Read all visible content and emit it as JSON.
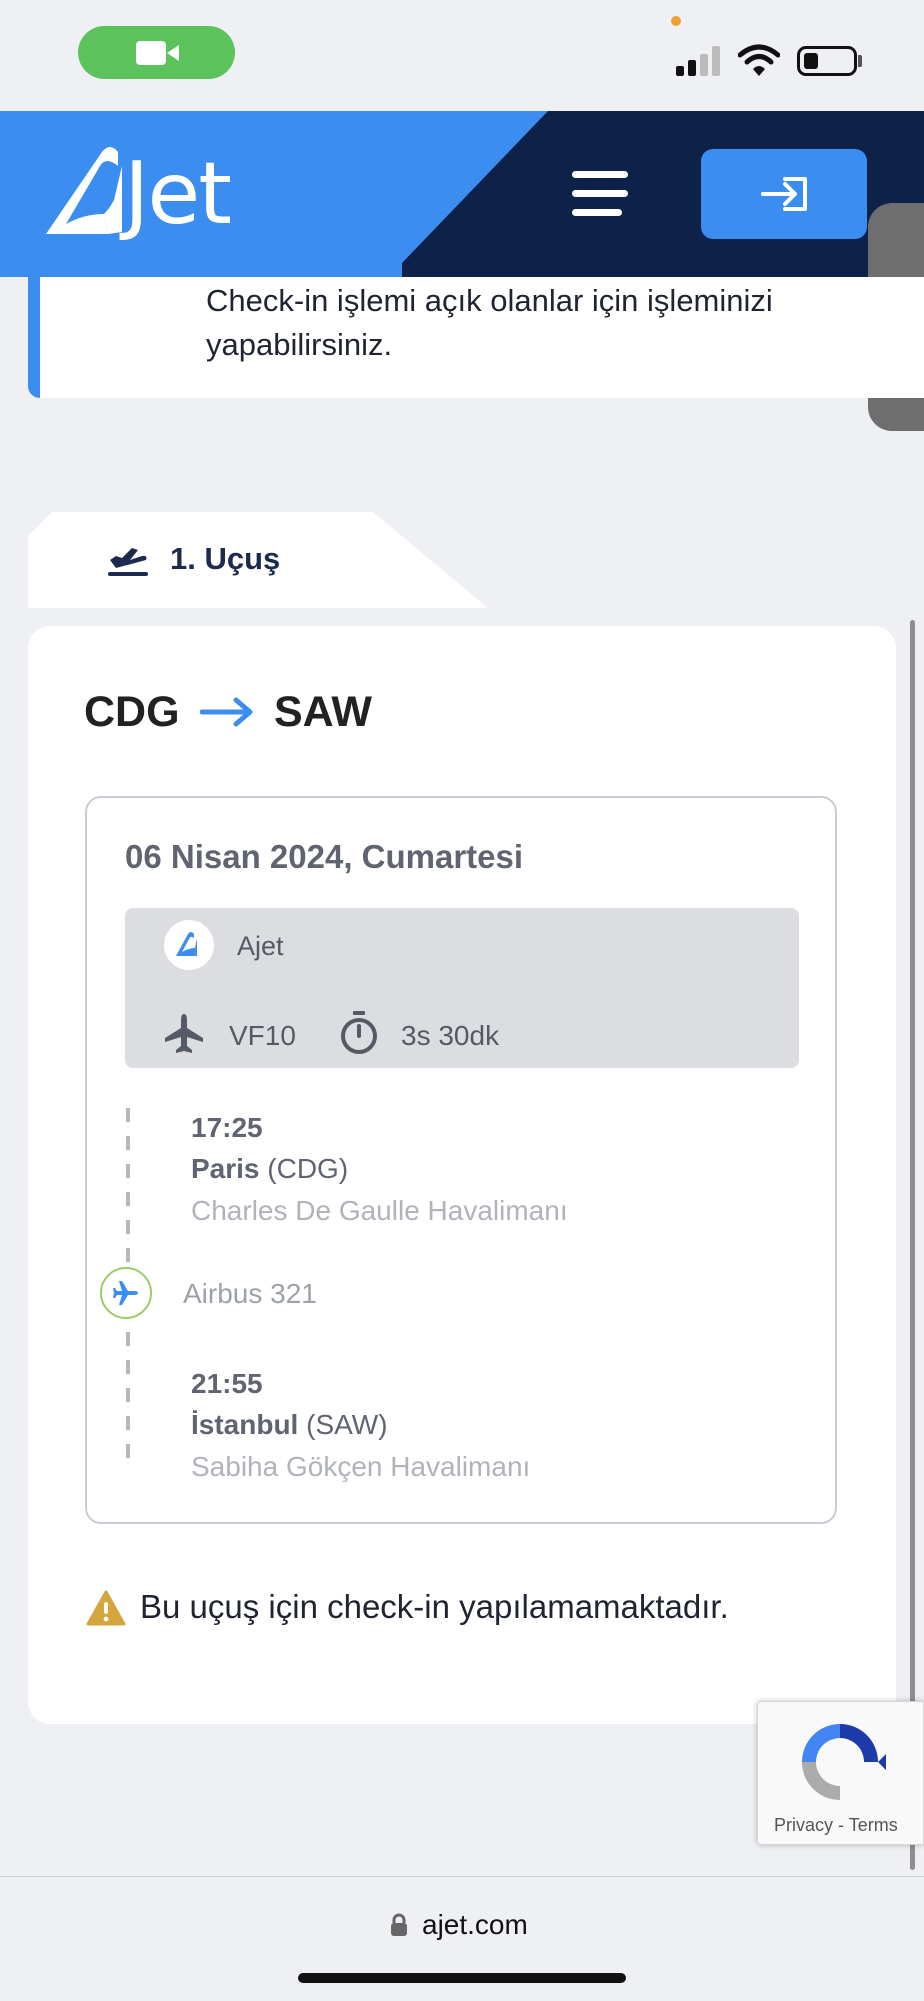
{
  "header": {
    "logo_text": "Jet",
    "menu_icon": "hamburger-menu-icon",
    "login_icon": "login-arrow-icon",
    "brand_color": "#3b8ef0",
    "dark_color": "#0d2149"
  },
  "info": {
    "text": "Check-in işlemi açık olanlar için işleminizi yapabilirsiniz."
  },
  "tab": {
    "label": "1. Uçuş",
    "icon": "plane-departure-icon"
  },
  "flight": {
    "route_from": "CDG",
    "route_to": "SAW",
    "date": "06 Nisan 2024, Cumartesi",
    "airline": "Ajet",
    "flight_no": "VF10",
    "duration": "3s 30dk",
    "aircraft": "Airbus 321",
    "departure": {
      "time": "17:25",
      "city": "Paris",
      "code": "(CDG)",
      "airport": "Charles De Gaulle Havalimanı"
    },
    "arrival": {
      "time": "21:55",
      "city": "İstanbul",
      "code": "(SAW)",
      "airport": "Sabiha Gökçen Havalimanı"
    }
  },
  "warning": {
    "text": "Bu uçuş için check-in yapılamamaktadır.",
    "icon": "warning-triangle-icon"
  },
  "recaptcha": {
    "privacy": "Privacy",
    "separator": "-",
    "terms": "Terms"
  },
  "browser": {
    "url": "ajet.com"
  }
}
